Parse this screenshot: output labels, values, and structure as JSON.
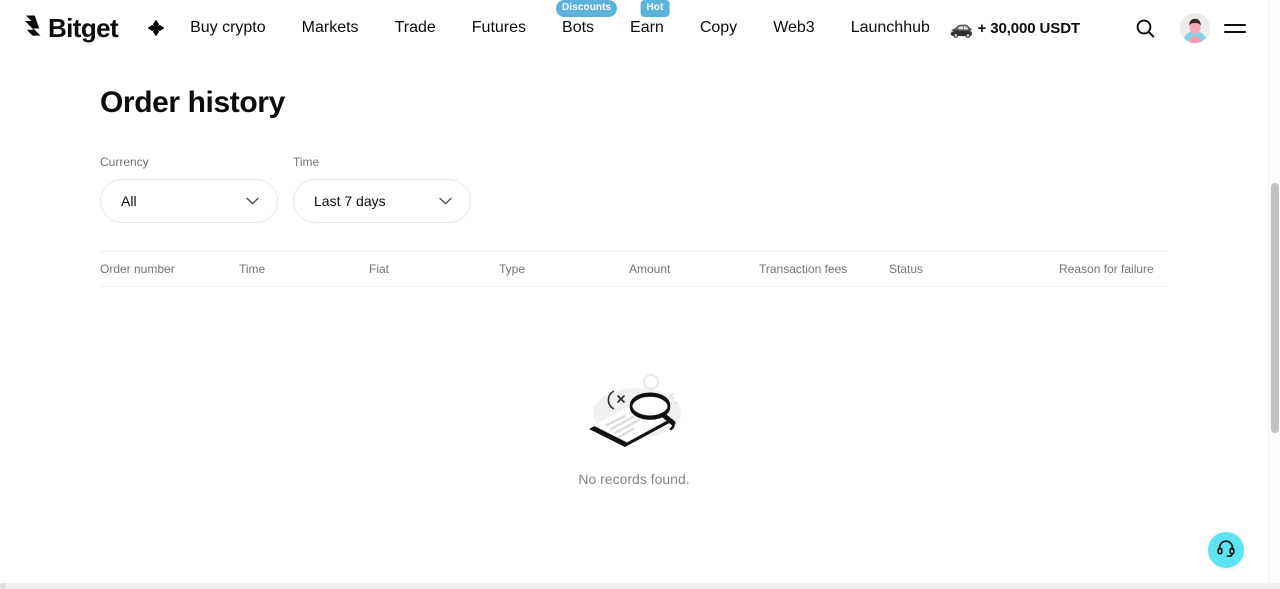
{
  "header": {
    "brand": {
      "name": "Bitget",
      "logo_icon": "bitget-logo-icon",
      "apps_icon": "four-diamonds-icon"
    },
    "nav": [
      {
        "label": "Buy crypto",
        "badge": null
      },
      {
        "label": "Markets",
        "badge": null
      },
      {
        "label": "Trade",
        "badge": null
      },
      {
        "label": "Futures",
        "badge": null
      },
      {
        "label": "Bots",
        "badge": "Discounts"
      },
      {
        "label": "Earn",
        "badge": "Hot"
      },
      {
        "label": "Copy",
        "badge": null
      },
      {
        "label": "Web3",
        "badge": null
      },
      {
        "label": "Launchhub",
        "badge": null
      }
    ],
    "promo": {
      "icon": "sports-car-icon",
      "label": "+ 30,000 USDT"
    },
    "search_icon": "search-icon",
    "avatar_icon": "user-avatar",
    "menu_icon": "hamburger-menu-icon"
  },
  "main": {
    "title": "Order history",
    "filters": [
      {
        "label": "Currency",
        "value": "All",
        "name": "currency"
      },
      {
        "label": "Time",
        "value": "Last 7 days",
        "name": "time"
      }
    ],
    "table": {
      "columns": [
        "Order number",
        "Time",
        "Fiat",
        "Type",
        "Amount",
        "Transaction fees",
        "Status",
        "Reason for failure"
      ],
      "rows": [],
      "empty_text": "No records found.",
      "empty_illustration": "no-records-illustration"
    }
  },
  "support": {
    "icon": "headset-icon",
    "color": "#5de4f2"
  },
  "badge_color": "#5cb3da"
}
